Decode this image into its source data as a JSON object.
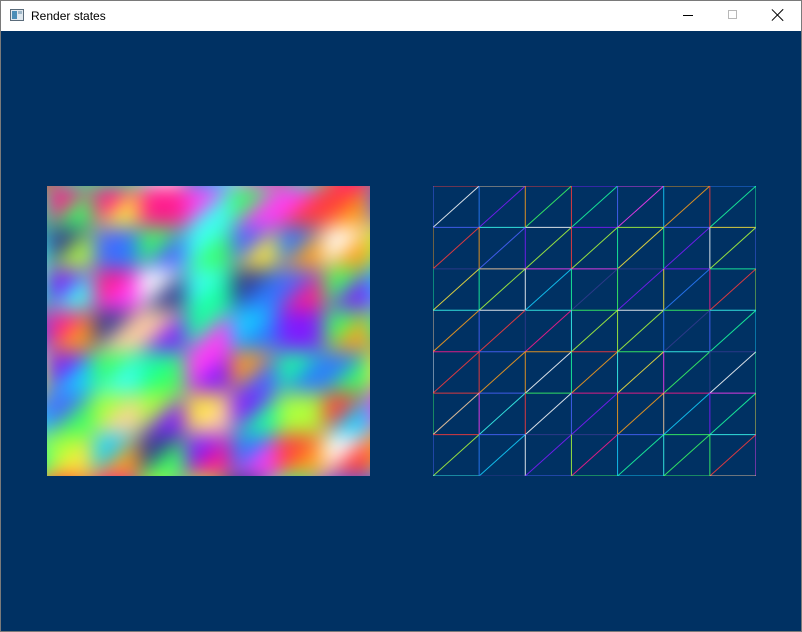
{
  "window": {
    "title": "Render states",
    "icon": "app-window-icon",
    "controls": {
      "minimize": "minimize-icon",
      "maximize": "maximize-icon",
      "close": "close-icon"
    }
  },
  "scene": {
    "background_color": "#003163",
    "left_render": {
      "state": "solid"
    },
    "right_render": {
      "state": "wireframe"
    }
  }
}
